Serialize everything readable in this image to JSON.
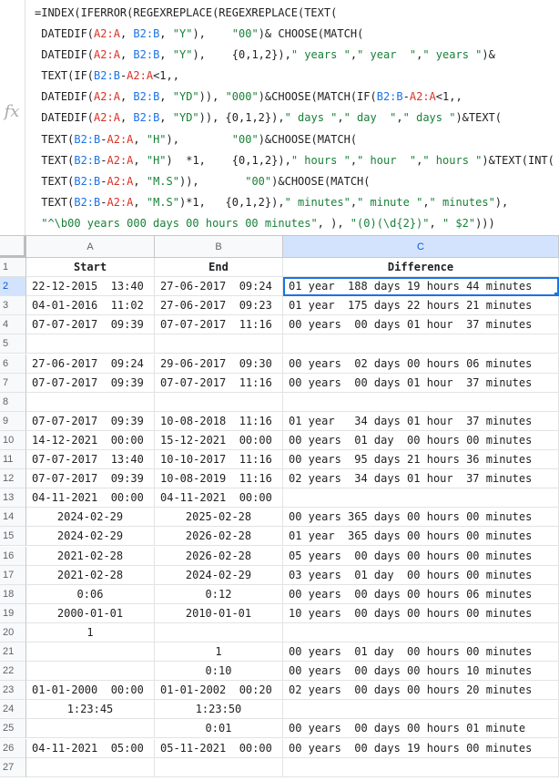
{
  "formula_bar": {
    "fx_label": "fx",
    "lines": [
      [
        [
          "=INDEX(IFERROR(REGEXREPLACE(REGEXREPLACE(TEXT(",
          ""
        ]
      ],
      [
        [
          " DATEDIF(",
          ""
        ],
        [
          "A2:A",
          "r"
        ],
        [
          ", ",
          ""
        ],
        [
          "B2:B",
          "b"
        ],
        [
          ", ",
          ""
        ],
        [
          "\"Y\"",
          "g"
        ],
        [
          "),    ",
          ""
        ],
        [
          "\"00\"",
          "g"
        ],
        [
          ")& CHOOSE(MATCH(",
          ""
        ]
      ],
      [
        [
          " DATEDIF(",
          ""
        ],
        [
          "A2:A",
          "r"
        ],
        [
          ", ",
          ""
        ],
        [
          "B2:B",
          "b"
        ],
        [
          ", ",
          ""
        ],
        [
          "\"Y\"",
          "g"
        ],
        [
          "),    {0,1,2}),",
          ""
        ],
        [
          "\" years \"",
          "g"
        ],
        [
          ",",
          ""
        ],
        [
          "\" year  \"",
          "g"
        ],
        [
          ",",
          ""
        ],
        [
          "\" years \"",
          "g"
        ],
        [
          ")&",
          ""
        ]
      ],
      [
        [
          " TEXT(IF(",
          ""
        ],
        [
          "B2:B",
          "b"
        ],
        [
          "-",
          ""
        ],
        [
          "A2:A",
          "r"
        ],
        [
          "<1,,",
          ""
        ]
      ],
      [
        [
          " DATEDIF(",
          ""
        ],
        [
          "A2:A",
          "r"
        ],
        [
          ", ",
          ""
        ],
        [
          "B2:B",
          "b"
        ],
        [
          ", ",
          ""
        ],
        [
          "\"YD\"",
          "g"
        ],
        [
          ")), ",
          ""
        ],
        [
          "\"000\"",
          "g"
        ],
        [
          ")&CHOOSE(MATCH(IF(",
          ""
        ],
        [
          "B2:B",
          "b"
        ],
        [
          "-",
          ""
        ],
        [
          "A2:A",
          "r"
        ],
        [
          "<1,,",
          ""
        ]
      ],
      [
        [
          " DATEDIF(",
          ""
        ],
        [
          "A2:A",
          "r"
        ],
        [
          ", ",
          ""
        ],
        [
          "B2:B",
          "b"
        ],
        [
          ", ",
          ""
        ],
        [
          "\"YD\"",
          "g"
        ],
        [
          ")), {0,1,2}),",
          ""
        ],
        [
          "\" days \"",
          "g"
        ],
        [
          ",",
          ""
        ],
        [
          "\" day  \"",
          "g"
        ],
        [
          ",",
          ""
        ],
        [
          "\" days \"",
          "g"
        ],
        [
          ")&TEXT(",
          ""
        ]
      ],
      [
        [
          " TEXT(",
          ""
        ],
        [
          "B2:B",
          "b"
        ],
        [
          "-",
          ""
        ],
        [
          "A2:A",
          "r"
        ],
        [
          ", ",
          ""
        ],
        [
          "\"H\"",
          "g"
        ],
        [
          "),        ",
          ""
        ],
        [
          "\"00\"",
          "g"
        ],
        [
          ")&CHOOSE(MATCH(",
          ""
        ]
      ],
      [
        [
          " TEXT(",
          ""
        ],
        [
          "B2:B",
          "b"
        ],
        [
          "-",
          ""
        ],
        [
          "A2:A",
          "r"
        ],
        [
          ", ",
          ""
        ],
        [
          "\"H\"",
          "g"
        ],
        [
          ")  *1,    {0,1,2}),",
          ""
        ],
        [
          "\" hours \"",
          "g"
        ],
        [
          ",",
          ""
        ],
        [
          "\" hour  \"",
          "g"
        ],
        [
          ",",
          ""
        ],
        [
          "\" hours \"",
          "g"
        ],
        [
          ")&TEXT(INT(",
          ""
        ]
      ],
      [
        [
          " TEXT(",
          ""
        ],
        [
          "B2:B",
          "b"
        ],
        [
          "-",
          ""
        ],
        [
          "A2:A",
          "r"
        ],
        [
          ", ",
          ""
        ],
        [
          "\"M.S\"",
          "g"
        ],
        [
          ")),       ",
          ""
        ],
        [
          "\"00\"",
          "g"
        ],
        [
          ")&CHOOSE(MATCH(",
          ""
        ]
      ],
      [
        [
          " TEXT(",
          ""
        ],
        [
          "B2:B",
          "b"
        ],
        [
          "-",
          ""
        ],
        [
          "A2:A",
          "r"
        ],
        [
          ", ",
          ""
        ],
        [
          "\"M.S\"",
          "g"
        ],
        [
          ")*1,   {0,1,2}),",
          ""
        ],
        [
          "\" minutes\"",
          "g"
        ],
        [
          ",",
          ""
        ],
        [
          "\" minute \"",
          "g"
        ],
        [
          ",",
          ""
        ],
        [
          "\" minutes\"",
          "g"
        ],
        [
          "),",
          ""
        ]
      ],
      [
        [
          " ",
          ""
        ],
        [
          "\"^\\b00 years 000 days 00 hours 00 minutes\"",
          "g"
        ],
        [
          ", ), ",
          ""
        ],
        [
          "\"(0)(\\d{2})\"",
          "g"
        ],
        [
          ", ",
          ""
        ],
        [
          "\" $2\"",
          "g"
        ],
        [
          ")))",
          ""
        ]
      ]
    ]
  },
  "columns": [
    "A",
    "B",
    "C"
  ],
  "rows": [
    {
      "n": "1",
      "a": "Start",
      "b": "End",
      "c": "Difference",
      "header": true
    },
    {
      "n": "2",
      "a": "22-12-2015  13:40",
      "b": "27-06-2017  09:24",
      "c": "01 year  188 days 19 hours 44 minutes"
    },
    {
      "n": "3",
      "a": "04-01-2016  11:02",
      "b": "27-06-2017  09:23",
      "c": "01 year  175 days 22 hours 21 minutes"
    },
    {
      "n": "4",
      "a": "07-07-2017  09:39",
      "b": "07-07-2017  11:16",
      "c": "00 years  00 days 01 hour  37 minutes"
    },
    {
      "n": "5",
      "a": "",
      "b": "",
      "c": ""
    },
    {
      "n": "6",
      "a": "27-06-2017  09:24",
      "b": "29-06-2017  09:30",
      "c": "00 years  02 days 00 hours 06 minutes"
    },
    {
      "n": "7",
      "a": "07-07-2017  09:39",
      "b": "07-07-2017  11:16",
      "c": "00 years  00 days 01 hour  37 minutes"
    },
    {
      "n": "8",
      "a": "",
      "b": "",
      "c": ""
    },
    {
      "n": "9",
      "a": "07-07-2017  09:39",
      "b": "10-08-2018  11:16",
      "c": "01 year   34 days 01 hour  37 minutes"
    },
    {
      "n": "10",
      "a": "14-12-2021  00:00",
      "b": "15-12-2021  00:00",
      "c": "00 years  01 day  00 hours 00 minutes"
    },
    {
      "n": "11",
      "a": "07-07-2017  13:40",
      "b": "10-10-2017  11:16",
      "c": "00 years  95 days 21 hours 36 minutes"
    },
    {
      "n": "12",
      "a": "07-07-2017  09:39",
      "b": "10-08-2019  11:16",
      "c": "02 years  34 days 01 hour  37 minutes"
    },
    {
      "n": "13",
      "a": "04-11-2021  00:00",
      "b": "04-11-2021  00:00",
      "c": ""
    },
    {
      "n": "14",
      "a": "2024-02-29",
      "b": "2025-02-28",
      "c": "00 years 365 days 00 hours 00 minutes",
      "center": true
    },
    {
      "n": "15",
      "a": "2024-02-29",
      "b": "2026-02-28",
      "c": "01 year  365 days 00 hours 00 minutes",
      "center": true
    },
    {
      "n": "16",
      "a": "2021-02-28",
      "b": "2026-02-28",
      "c": "05 years  00 days 00 hours 00 minutes",
      "center": true
    },
    {
      "n": "17",
      "a": "2021-02-28",
      "b": "2024-02-29",
      "c": "03 years  01 day  00 hours 00 minutes",
      "center": true
    },
    {
      "n": "18",
      "a": "0:06",
      "b": "0:12",
      "c": "00 years  00 days 00 hours 06 minutes",
      "center": true
    },
    {
      "n": "19",
      "a": "2000-01-01",
      "b": "2010-01-01",
      "c": "10 years  00 days 00 hours 00 minutes",
      "center": true
    },
    {
      "n": "20",
      "a": "1",
      "b": "",
      "c": "",
      "center": true
    },
    {
      "n": "21",
      "a": "",
      "b": "1",
      "c": "00 years  01 day  00 hours 00 minutes",
      "center": true
    },
    {
      "n": "22",
      "a": "",
      "b": "0:10",
      "c": "00 years  00 days 00 hours 10 minutes",
      "center": true
    },
    {
      "n": "23",
      "a": "01-01-2000  00:00",
      "b": "01-01-2002  00:20",
      "c": "02 years  00 days 00 hours 20 minutes"
    },
    {
      "n": "24",
      "a": "1:23:45",
      "b": "1:23:50",
      "c": "",
      "center": true
    },
    {
      "n": "25",
      "a": "",
      "b": "0:01",
      "c": "00 years  00 days 00 hours 01 minute",
      "center": true
    },
    {
      "n": "26",
      "a": "04-11-2021  05:00",
      "b": "05-11-2021  00:00",
      "c": "00 years  00 days 19 hours 00 minutes"
    },
    {
      "n": "27",
      "a": "",
      "b": "",
      "c": ""
    }
  ],
  "selected_cell": "C2",
  "colors": {
    "accent": "#1a73e8",
    "range_a": "#d93025",
    "range_b": "#1a73e8",
    "string": "#188038"
  }
}
